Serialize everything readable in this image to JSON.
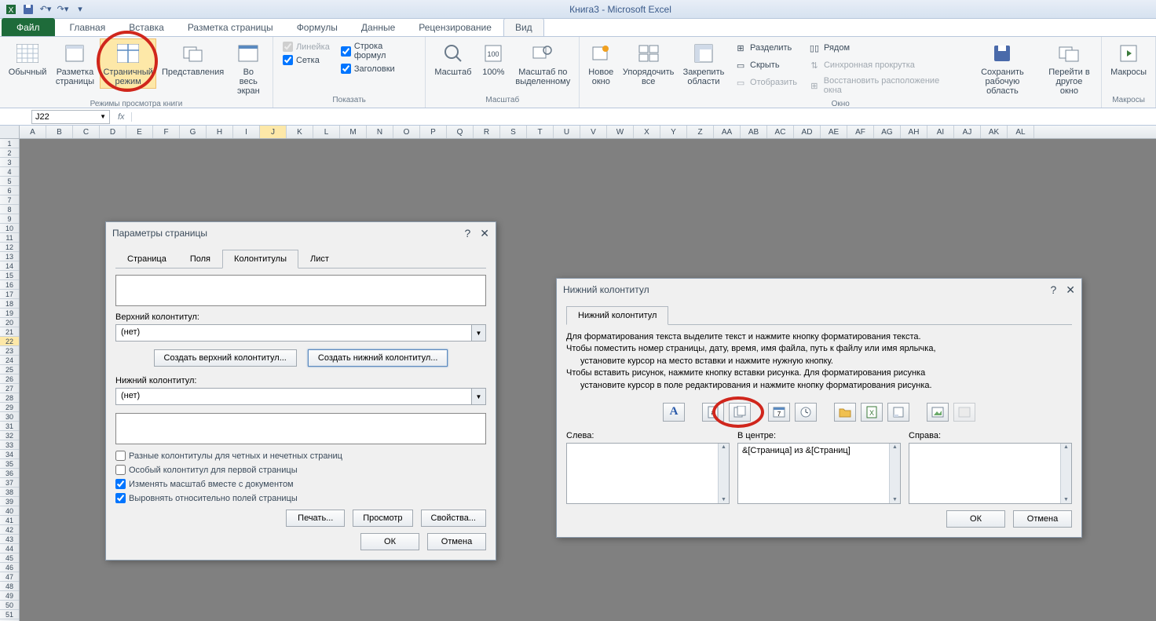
{
  "app_title": "Книга3  -  Microsoft Excel",
  "tabs": {
    "file": "Файл",
    "home": "Главная",
    "insert": "Вставка",
    "layout": "Разметка страницы",
    "formulas": "Формулы",
    "data": "Данные",
    "review": "Рецензирование",
    "view": "Вид"
  },
  "ribbon": {
    "view_modes": {
      "normal": "Обычный",
      "page_layout": "Разметка\nстраницы",
      "page_break": "Страничный\nрежим",
      "custom_views": "Представления",
      "full_screen": "Во весь\nэкран",
      "group": "Режимы просмотра книги"
    },
    "show": {
      "ruler": "Линейка",
      "formula_bar": "Строка формул",
      "gridlines": "Сетка",
      "headings": "Заголовки",
      "group": "Показать"
    },
    "zoom": {
      "zoom": "Масштаб",
      "hundred": "100%",
      "selection": "Масштаб по\nвыделенному",
      "group": "Масштаб"
    },
    "window": {
      "new": "Новое\nокно",
      "arrange": "Упорядочить\nвсе",
      "freeze": "Закрепить\nобласти",
      "split": "Разделить",
      "hide": "Скрыть",
      "unhide": "Отобразить",
      "side": "Рядом",
      "sync": "Синхронная прокрутка",
      "reset": "Восстановить расположение окна",
      "save_ws": "Сохранить\nрабочую область",
      "switch": "Перейти в\nдругое окно",
      "group": "Окно"
    },
    "macros": {
      "macros": "Макросы",
      "group": "Макросы"
    }
  },
  "namebox": "J22",
  "columns": [
    "A",
    "B",
    "C",
    "D",
    "E",
    "F",
    "G",
    "H",
    "I",
    "J",
    "K",
    "L",
    "M",
    "N",
    "O",
    "P",
    "Q",
    "R",
    "S",
    "T",
    "U",
    "V",
    "W",
    "X",
    "Y",
    "Z",
    "AA",
    "AB",
    "AC",
    "AD",
    "AE",
    "AF",
    "AG",
    "AH",
    "AI",
    "AJ",
    "AK",
    "AL"
  ],
  "dialog1": {
    "title": "Параметры страницы",
    "tabs": {
      "page": "Страница",
      "margins": "Поля",
      "headerfooter": "Колонтитулы",
      "sheet": "Лист"
    },
    "header_label": "Верхний колонтитул:",
    "none_value": "(нет)",
    "create_header": "Создать верхний колонтитул...",
    "create_footer": "Создать нижний колонтитул...",
    "footer_label": "Нижний колонтитул:",
    "chk_diff": "Разные колонтитулы для четных и нечетных страниц",
    "chk_first": "Особый колонтитул для первой страницы",
    "chk_scale": "Изменять масштаб вместе с документом",
    "chk_align": "Выровнять относительно полей страницы",
    "btn_print": "Печать...",
    "btn_preview": "Просмотр",
    "btn_props": "Свойства...",
    "ok": "ОК",
    "cancel": "Отмена"
  },
  "dialog2": {
    "title": "Нижний колонтитул",
    "tab": "Нижний колонтитул",
    "instr1": "Для форматирования текста выделите текст и нажмите кнопку форматирования текста.",
    "instr2": "Чтобы поместить номер страницы, дату, время, имя файла, путь к файлу или имя ярлычка,",
    "instr2b": "установите курсор на место вставки и нажмите нужную кнопку.",
    "instr3": "Чтобы вставить рисунок, нажмите кнопку вставки рисунка.  Для форматирования рисунка",
    "instr3b": "установите курсор в поле редактирования и нажмите кнопку форматирования рисунка.",
    "left": "Слева:",
    "center": "В центре:",
    "right": "Справа:",
    "center_value": "&[Страница] из &[Страниц]",
    "ok": "ОК",
    "cancel": "Отмена"
  }
}
